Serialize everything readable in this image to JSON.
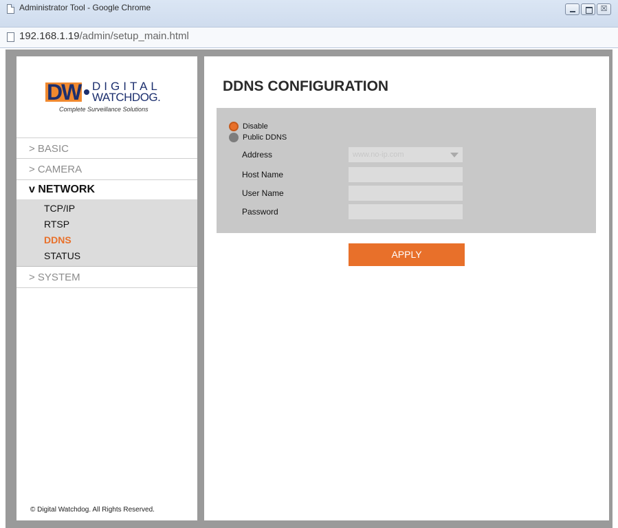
{
  "window": {
    "title": "Administrator Tool - Google Chrome",
    "close_glyph": "☒"
  },
  "address": {
    "host": "192.168.1.19",
    "path": "/admin/setup_main.html"
  },
  "logo": {
    "mark": "DW",
    "line1": "DIGITAL",
    "line2": "WATCHDOG.",
    "tagline": "Complete Surveillance Solutions"
  },
  "menu": {
    "basic": "> BASIC",
    "camera": "> CAMERA",
    "network": "v NETWORK",
    "network_items": [
      "TCP/IP",
      "RTSP",
      "DDNS",
      "STATUS"
    ],
    "active_item": "DDNS",
    "system": "> SYSTEM"
  },
  "copyright": "© Digital Watchdog. All Rights Reserved.",
  "content": {
    "title": "DDNS CONFIGURATION",
    "options": [
      "Disable",
      "Public DDNS"
    ],
    "selected_option": "Disable",
    "fields": {
      "address_label": "Address",
      "address_value": "www.no-ip.com",
      "host_label": "Host Name",
      "user_label": "User Name",
      "password_label": "Password"
    },
    "apply_label": "APPLY"
  },
  "colors": {
    "accent": "#e8702a",
    "panel": "#c8c8c8",
    "brand_blue": "#1c2f6e"
  }
}
